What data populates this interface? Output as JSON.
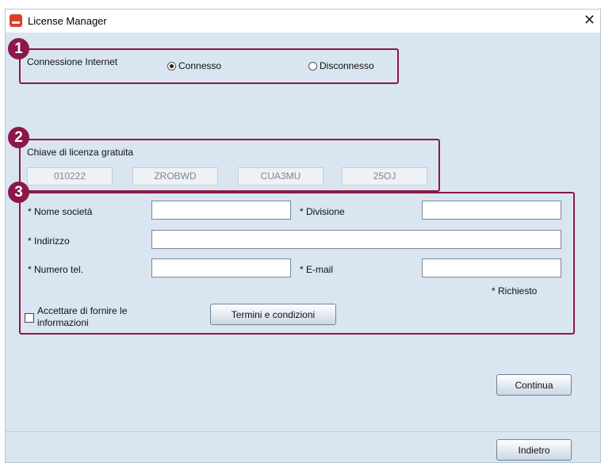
{
  "window": {
    "title": "License Manager",
    "close_glyph": "✕"
  },
  "markers": [
    "1",
    "2",
    "3"
  ],
  "connection": {
    "label": "Connessione Internet",
    "options": [
      {
        "label": "Connesso",
        "selected": true
      },
      {
        "label": "Disconnesso",
        "selected": false
      }
    ]
  },
  "license_key": {
    "label": "Chiave di licenza gratuita",
    "segments": [
      "010222",
      "ZROBWD",
      "CUA3MU",
      "25OJ"
    ]
  },
  "form": {
    "company_label": "* Nome società",
    "company_value": "",
    "division_label": "* Divisione",
    "division_value": "",
    "address_label": "* Indirizzo",
    "address_value": "",
    "phone_label": "* Numero tel.",
    "phone_value": "",
    "email_label": "* E-mail",
    "email_value": "",
    "required_note": "* Richiesto",
    "consent_line1": "Accettare di fornire le",
    "consent_line2": "informazioni",
    "consent_checked": false,
    "terms_button": "Termini e condizioni"
  },
  "buttons": {
    "continue": "Continua",
    "back": "Indietro"
  },
  "colors": {
    "marker": "#8b1848",
    "window_bg": "#d9e5f0"
  }
}
